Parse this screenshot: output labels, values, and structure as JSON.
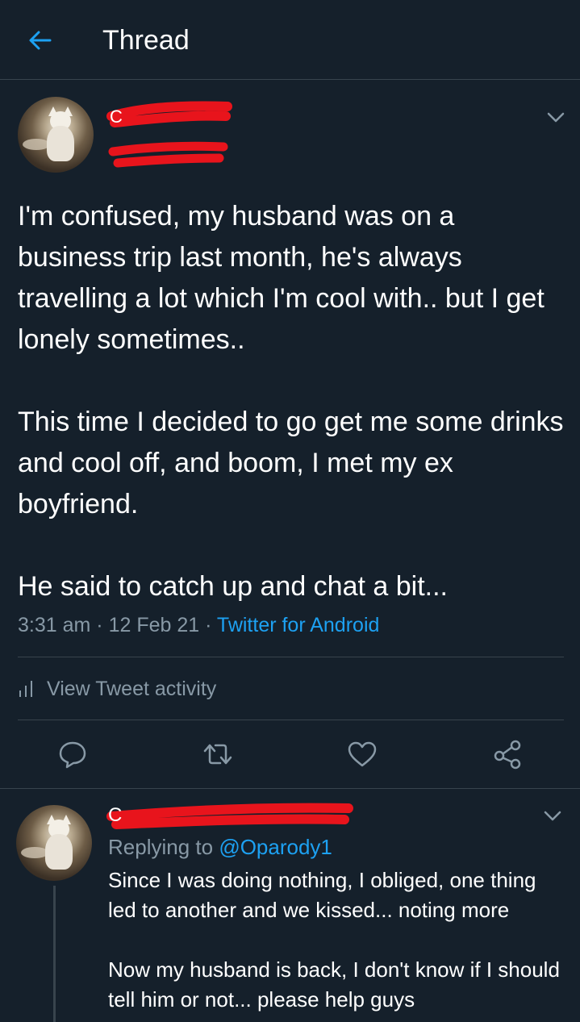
{
  "header": {
    "title": "Thread"
  },
  "tweet": {
    "text": "I'm confused, my husband was on a business trip last month, he's always travelling a lot which I'm cool with.. but I get lonely sometimes..\n\nThis time I decided to go get me some drinks and cool off, and boom, I met my ex boyfriend.\n\nHe said to catch up and chat a bit...",
    "time": "3:31 am",
    "date": "12 Feb 21",
    "source": "Twitter for Android",
    "activity_label": "View Tweet activity"
  },
  "reply": {
    "replying_prefix": "Replying to",
    "replying_handle": "@Oparody1",
    "text": "Since I was doing nothing, I obliged, one thing led to another and we kissed... noting more\n\nNow my husband is back, I don't know if I should tell him or not... please help guys"
  },
  "colors": {
    "background": "#15202b",
    "divider": "#38444d",
    "secondary_text": "#8899a6",
    "accent": "#1da1f2",
    "redaction": "#e8141c"
  },
  "icons": {
    "back": "arrow-left-icon",
    "more": "chevron-down-icon",
    "activity": "bar-chart-icon",
    "reply": "comment-icon",
    "retweet": "retweet-icon",
    "like": "heart-icon",
    "share": "share-icon"
  }
}
